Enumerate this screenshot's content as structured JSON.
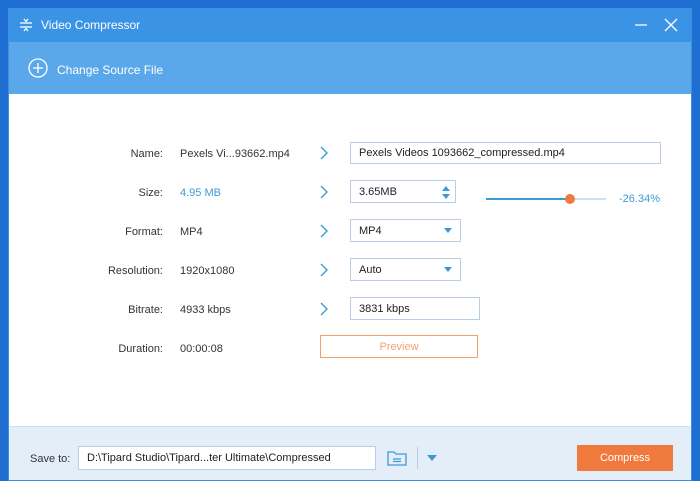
{
  "window": {
    "title": "Video Compressor"
  },
  "toolbar": {
    "change_source_label": "Change Source File"
  },
  "rows": {
    "name": {
      "label": "Name:",
      "source": "Pexels Vi...93662.mp4",
      "output": "Pexels Videos 1093662_compressed.mp4"
    },
    "size": {
      "label": "Size:",
      "source": "4.95 MB",
      "output": "3.65MB",
      "slider_percent": 70,
      "change": "-26.34%"
    },
    "format": {
      "label": "Format:",
      "source": "MP4",
      "output": "MP4"
    },
    "resolution": {
      "label": "Resolution:",
      "source": "1920x1080",
      "output": "Auto"
    },
    "bitrate": {
      "label": "Bitrate:",
      "source": "4933 kbps",
      "output": "3831 kbps"
    },
    "duration": {
      "label": "Duration:",
      "source": "00:00:08"
    }
  },
  "preview_label": "Preview",
  "footer": {
    "save_to_label": "Save to:",
    "path": "D:\\Tipard Studio\\Tipard...ter Ultimate\\Compressed",
    "compress_label": "Compress"
  },
  "colors": {
    "titlebar": "#3b93e6",
    "toolbar": "#5aa8ea",
    "accent_blue": "#3d9ad8",
    "accent_orange": "#f07a3d"
  }
}
